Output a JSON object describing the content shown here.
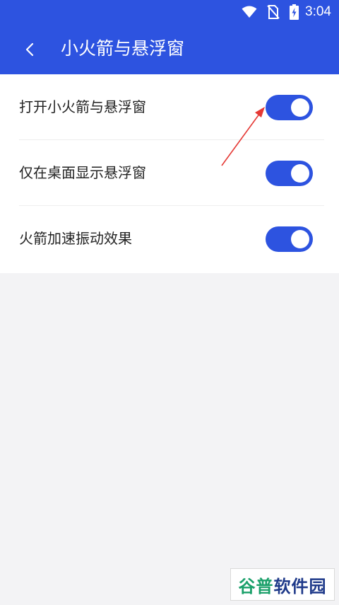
{
  "status_bar": {
    "time": "3:04",
    "icons": [
      "wifi-icon",
      "no-sim-icon",
      "battery-charging-icon"
    ]
  },
  "header": {
    "back_icon": "chevron-left-icon",
    "title": "小火箭与悬浮窗"
  },
  "settings": [
    {
      "label": "打开小火箭与悬浮窗",
      "enabled": true
    },
    {
      "label": "仅在桌面显示悬浮窗",
      "enabled": true
    },
    {
      "label": "火箭加速振动效果",
      "enabled": true
    }
  ],
  "watermark": {
    "part1": "谷普",
    "part2": "软件园"
  },
  "colors": {
    "primary": "#2d53e0",
    "annotation_arrow": "#e53935",
    "background": "#f3f3f5"
  }
}
